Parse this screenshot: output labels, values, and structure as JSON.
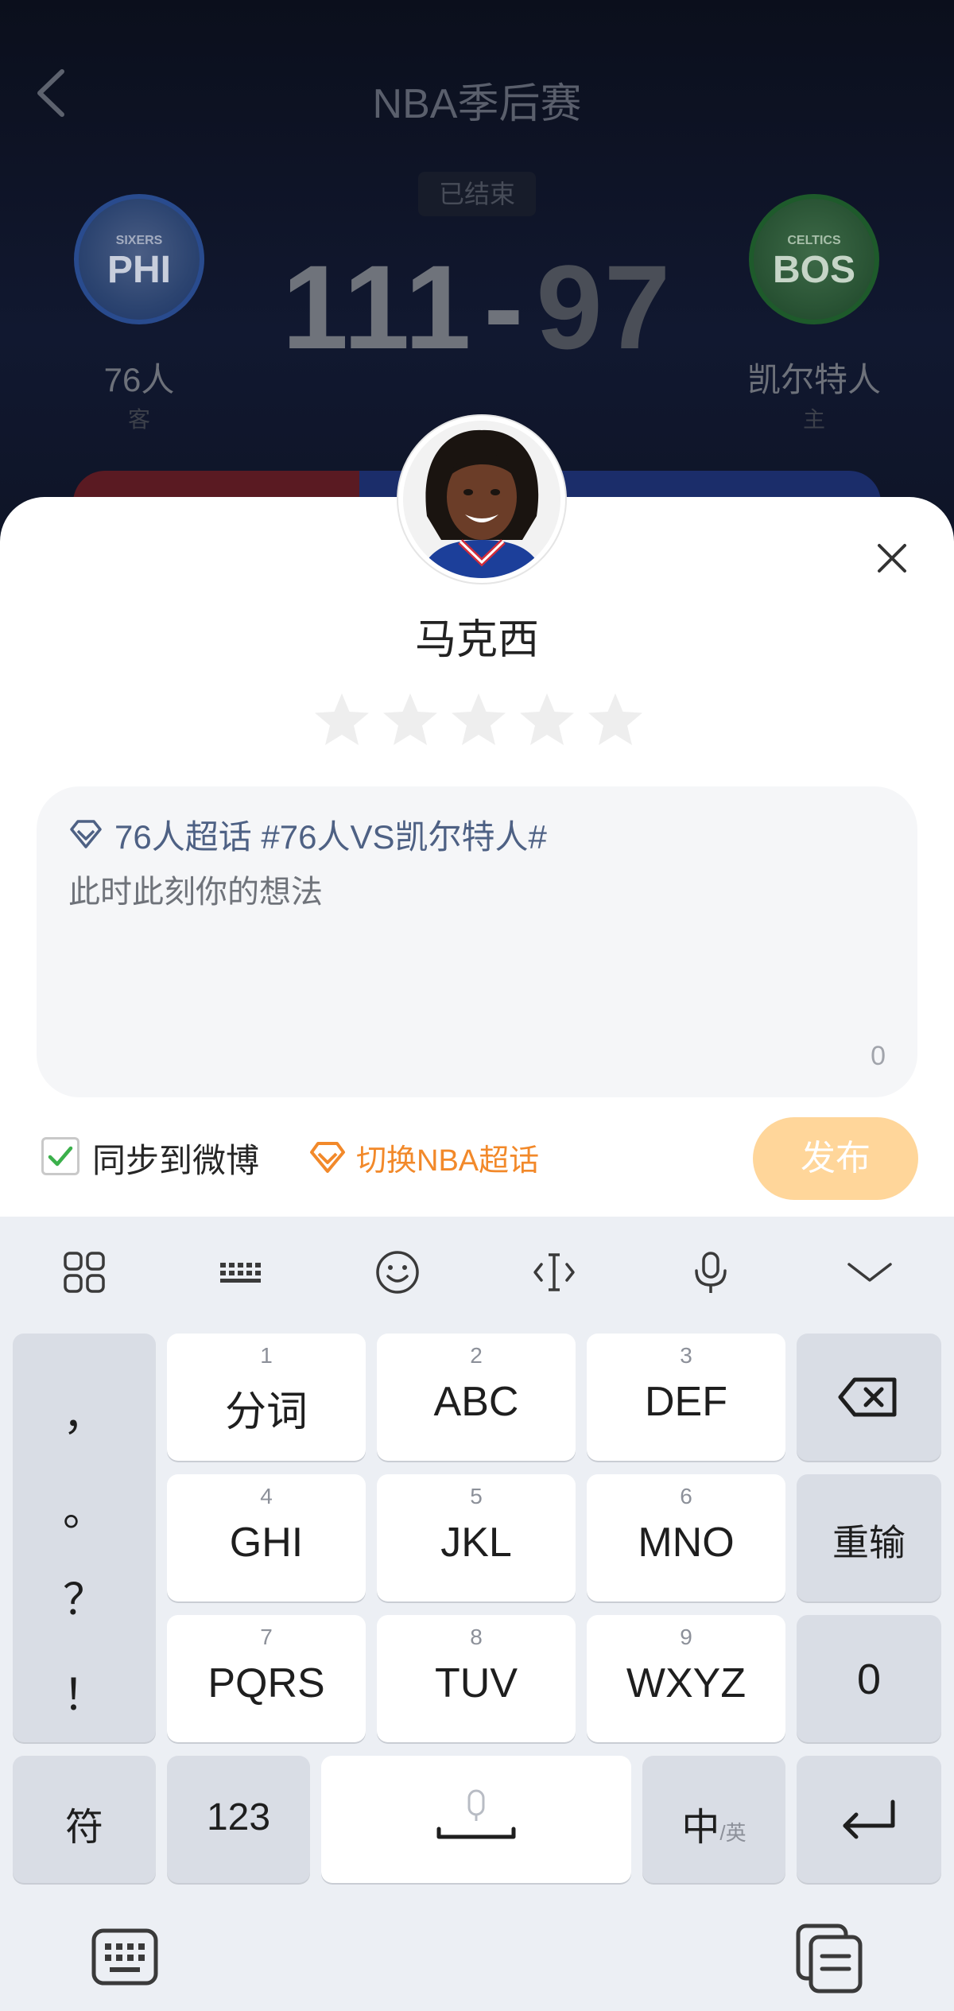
{
  "header": {
    "title": "NBA季后赛",
    "status": "已结束",
    "score_away": "111",
    "score_sep": "-",
    "score_home": "97",
    "away_team": {
      "name": "76人",
      "role": "客",
      "logo_small": "SIXERS",
      "logo_big": "PHI"
    },
    "home_team": {
      "name": "凯尔特人",
      "role": "主",
      "logo_small": "CELTICS",
      "logo_big": "BOS"
    }
  },
  "rating_sheet": {
    "player_name": "马克西",
    "stars_total": 5,
    "stars_selected": 0,
    "topic": "76人超话 #76人VS凯尔特人#",
    "placeholder": "此时此刻你的想法",
    "char_count": "0",
    "sync_label": "同步到微博",
    "sync_checked": true,
    "switch_topic_label": "切换NBA超话",
    "publish_label": "发布"
  },
  "keyboard": {
    "toolbar_icons": [
      "grid-icon",
      "keyboard-layout-icon",
      "emoji-icon",
      "cursor-icon",
      "microphone-icon",
      "collapse-icon"
    ],
    "punctuation": [
      "，",
      "。",
      "？",
      "！"
    ],
    "keys": [
      {
        "num": "1",
        "label": "分词"
      },
      {
        "num": "2",
        "label": "ABC"
      },
      {
        "num": "3",
        "label": "DEF"
      },
      {
        "num": "4",
        "label": "GHI"
      },
      {
        "num": "5",
        "label": "JKL"
      },
      {
        "num": "6",
        "label": "MNO"
      },
      {
        "num": "7",
        "label": "PQRS"
      },
      {
        "num": "8",
        "label": "TUV"
      },
      {
        "num": "9",
        "label": "WXYZ"
      }
    ],
    "retype_label": "重输",
    "zero_label": "0",
    "symbols_label": "符",
    "numbers_label": "123",
    "lang_main": "中",
    "lang_sub": "/英"
  },
  "colors": {
    "accent_orange": "#f2892a",
    "publish_disabled": "#ffd69a",
    "topic_blue": "#4e6184",
    "check_green": "#3bb04b"
  }
}
